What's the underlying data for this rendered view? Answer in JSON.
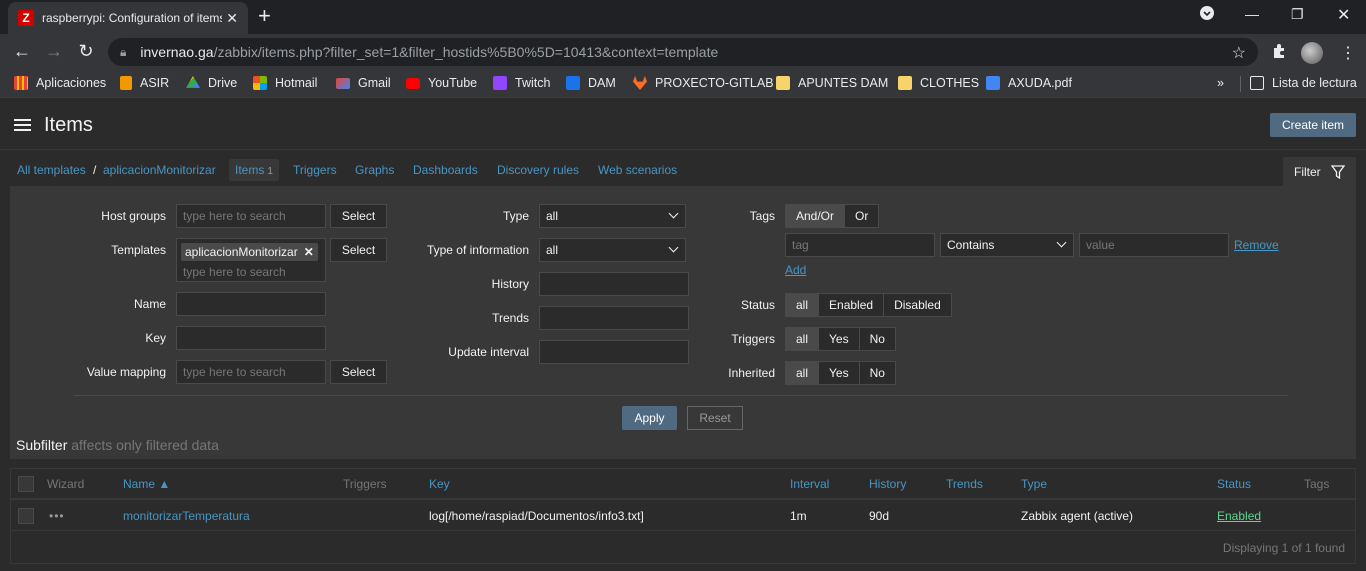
{
  "browser": {
    "tab_title": "raspberrypi: Configuration of items",
    "tab_favicon": "Z",
    "url_host": "invernao.ga",
    "url_path": "/zabbix/items.php?filter_set=1&filter_hostids%5B0%5D=10413&context=template",
    "bookmarks": [
      {
        "label": "Aplicaciones",
        "icon": "apps-grid-icon",
        "color": "#ea4335"
      },
      {
        "label": "ASIR",
        "icon": "bookmark-icon",
        "color": "#f29900"
      },
      {
        "label": "Drive",
        "icon": "drive-icon",
        "color": "#34a853"
      },
      {
        "label": "Hotmail",
        "icon": "microsoft-icon",
        "color": "#f25022"
      },
      {
        "label": "Gmail",
        "icon": "gmail-icon",
        "color": "#ea4335"
      },
      {
        "label": "YouTube",
        "icon": "youtube-icon",
        "color": "#ff0000"
      },
      {
        "label": "Twitch",
        "icon": "twitch-icon",
        "color": "#9146ff"
      },
      {
        "label": "DAM",
        "icon": "bookmark-icon",
        "color": "#1a73e8"
      },
      {
        "label": "PROXECTO-GITLAB",
        "icon": "gitlab-icon",
        "color": "#fc6d26"
      },
      {
        "label": "APUNTES DAM",
        "icon": "folder-icon",
        "color": "#f6d36b"
      },
      {
        "label": "CLOTHES",
        "icon": "folder-icon",
        "color": "#f6d36b"
      },
      {
        "label": "AXUDA.pdf",
        "icon": "pdf-icon",
        "color": "#4285f4"
      }
    ],
    "more_label": "»",
    "reading_list": "Lista de lectura"
  },
  "header": {
    "title": "Items",
    "create_label": "Create item"
  },
  "breadcrumbs": {
    "all_templates": "All templates",
    "separator": "/",
    "template": "aplicacionMonitorizar",
    "items_label": "Items",
    "items_count": "1",
    "triggers": "Triggers",
    "graphs": "Graphs",
    "dashboards": "Dashboards",
    "discovery": "Discovery rules",
    "web": "Web scenarios"
  },
  "filter": {
    "tab_label": "Filter",
    "host_groups_label": "Host groups",
    "host_groups_placeholder": "type here to search",
    "templates_label": "Templates",
    "templates_chip": "aplicacionMonitorizar",
    "templates_placeholder": "type here to search",
    "name_label": "Name",
    "key_label": "Key",
    "value_mapping_label": "Value mapping",
    "value_mapping_placeholder": "type here to search",
    "select_label": "Select",
    "type_label": "Type",
    "type_value": "all",
    "type_info_label": "Type of information",
    "type_info_value": "all",
    "history_label": "History",
    "trends_label": "Trends",
    "update_interval_label": "Update interval",
    "tags_label": "Tags",
    "tags_andor": "And/Or",
    "tags_or": "Or",
    "tag_placeholder": "tag",
    "tag_operator": "Contains",
    "value_placeholder": "value",
    "remove_label": "Remove",
    "add_label": "Add",
    "status_label": "Status",
    "status_options": [
      "all",
      "Enabled",
      "Disabled"
    ],
    "triggers_label": "Triggers",
    "triggers_options": [
      "all",
      "Yes",
      "No"
    ],
    "inherited_label": "Inherited",
    "inherited_options": [
      "all",
      "Yes",
      "No"
    ],
    "apply_label": "Apply",
    "reset_label": "Reset",
    "subfilter_title": "Subfilter",
    "subfilter_note": "affects only filtered data"
  },
  "table": {
    "headers": {
      "wizard": "Wizard",
      "name": "Name ▲",
      "triggers": "Triggers",
      "key": "Key",
      "interval": "Interval",
      "history": "History",
      "trends": "Trends",
      "type": "Type",
      "status": "Status",
      "tags": "Tags"
    },
    "rows": [
      {
        "wizard": "•••",
        "name": "monitorizarTemperatura",
        "key": "log[/home/raspiad/Documentos/info3.txt]",
        "interval": "1m",
        "history": "90d",
        "type": "Zabbix agent (active)",
        "status": "Enabled"
      }
    ],
    "footer": "Displaying 1 of 1 found"
  },
  "colors": {
    "accent": "#4796c4",
    "enabled": "#59db8f",
    "button": "#4f6a81"
  }
}
